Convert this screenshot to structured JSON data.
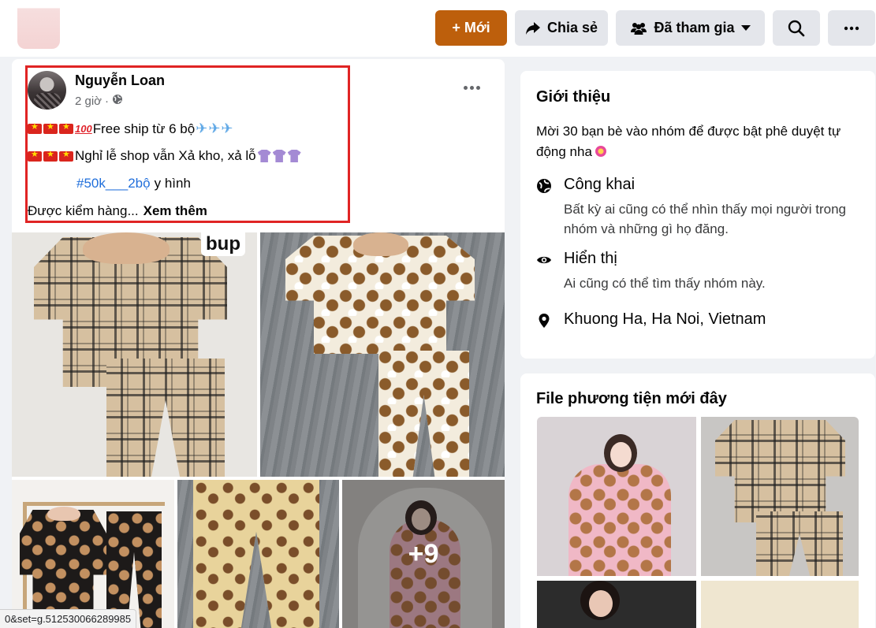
{
  "header": {
    "new_button": "+ Mới",
    "share_button": "Chia sẻ",
    "joined_button": "Đã tham gia",
    "search_icon": "search-icon",
    "more_icon": "more-horizontal-icon"
  },
  "post": {
    "author": "Nguyễn Loan",
    "time": "2 giờ",
    "separator": "·",
    "privacy_icon": "globe-icon",
    "line1_text": "Free ship từ 6 bộ",
    "line2_text": "Nghỉ lễ shop vẫn Xả kho, xả lỗ",
    "hashtag": "#50k___2bộ",
    "line3_text": "y hình",
    "line4_text": "Được kiểm hàng...",
    "see_more": "Xem thêm",
    "photo_badge": "bup",
    "more_photos": "+9"
  },
  "about": {
    "title": "Giới thiệu",
    "description": "Mời 30 bạn bè vào nhóm để được bật phê duyệt tự động nha",
    "public_title": "Công khai",
    "public_desc": "Bất kỳ ai cũng có thể nhìn thấy mọi người trong nhóm và những gì họ đăng.",
    "visible_title": "Hiển thị",
    "visible_desc": "Ai cũng có thể tìm thấy nhóm này.",
    "location": "Khuong Ha, Ha Noi, Vietnam"
  },
  "media": {
    "title": "File phương tiện mới đây"
  },
  "status_bar": {
    "url": "0&set=g.512530066289985"
  },
  "colors": {
    "new_button_bg": "#bd5f0c",
    "highlight_border": "#e02424",
    "link": "#216fdb"
  }
}
